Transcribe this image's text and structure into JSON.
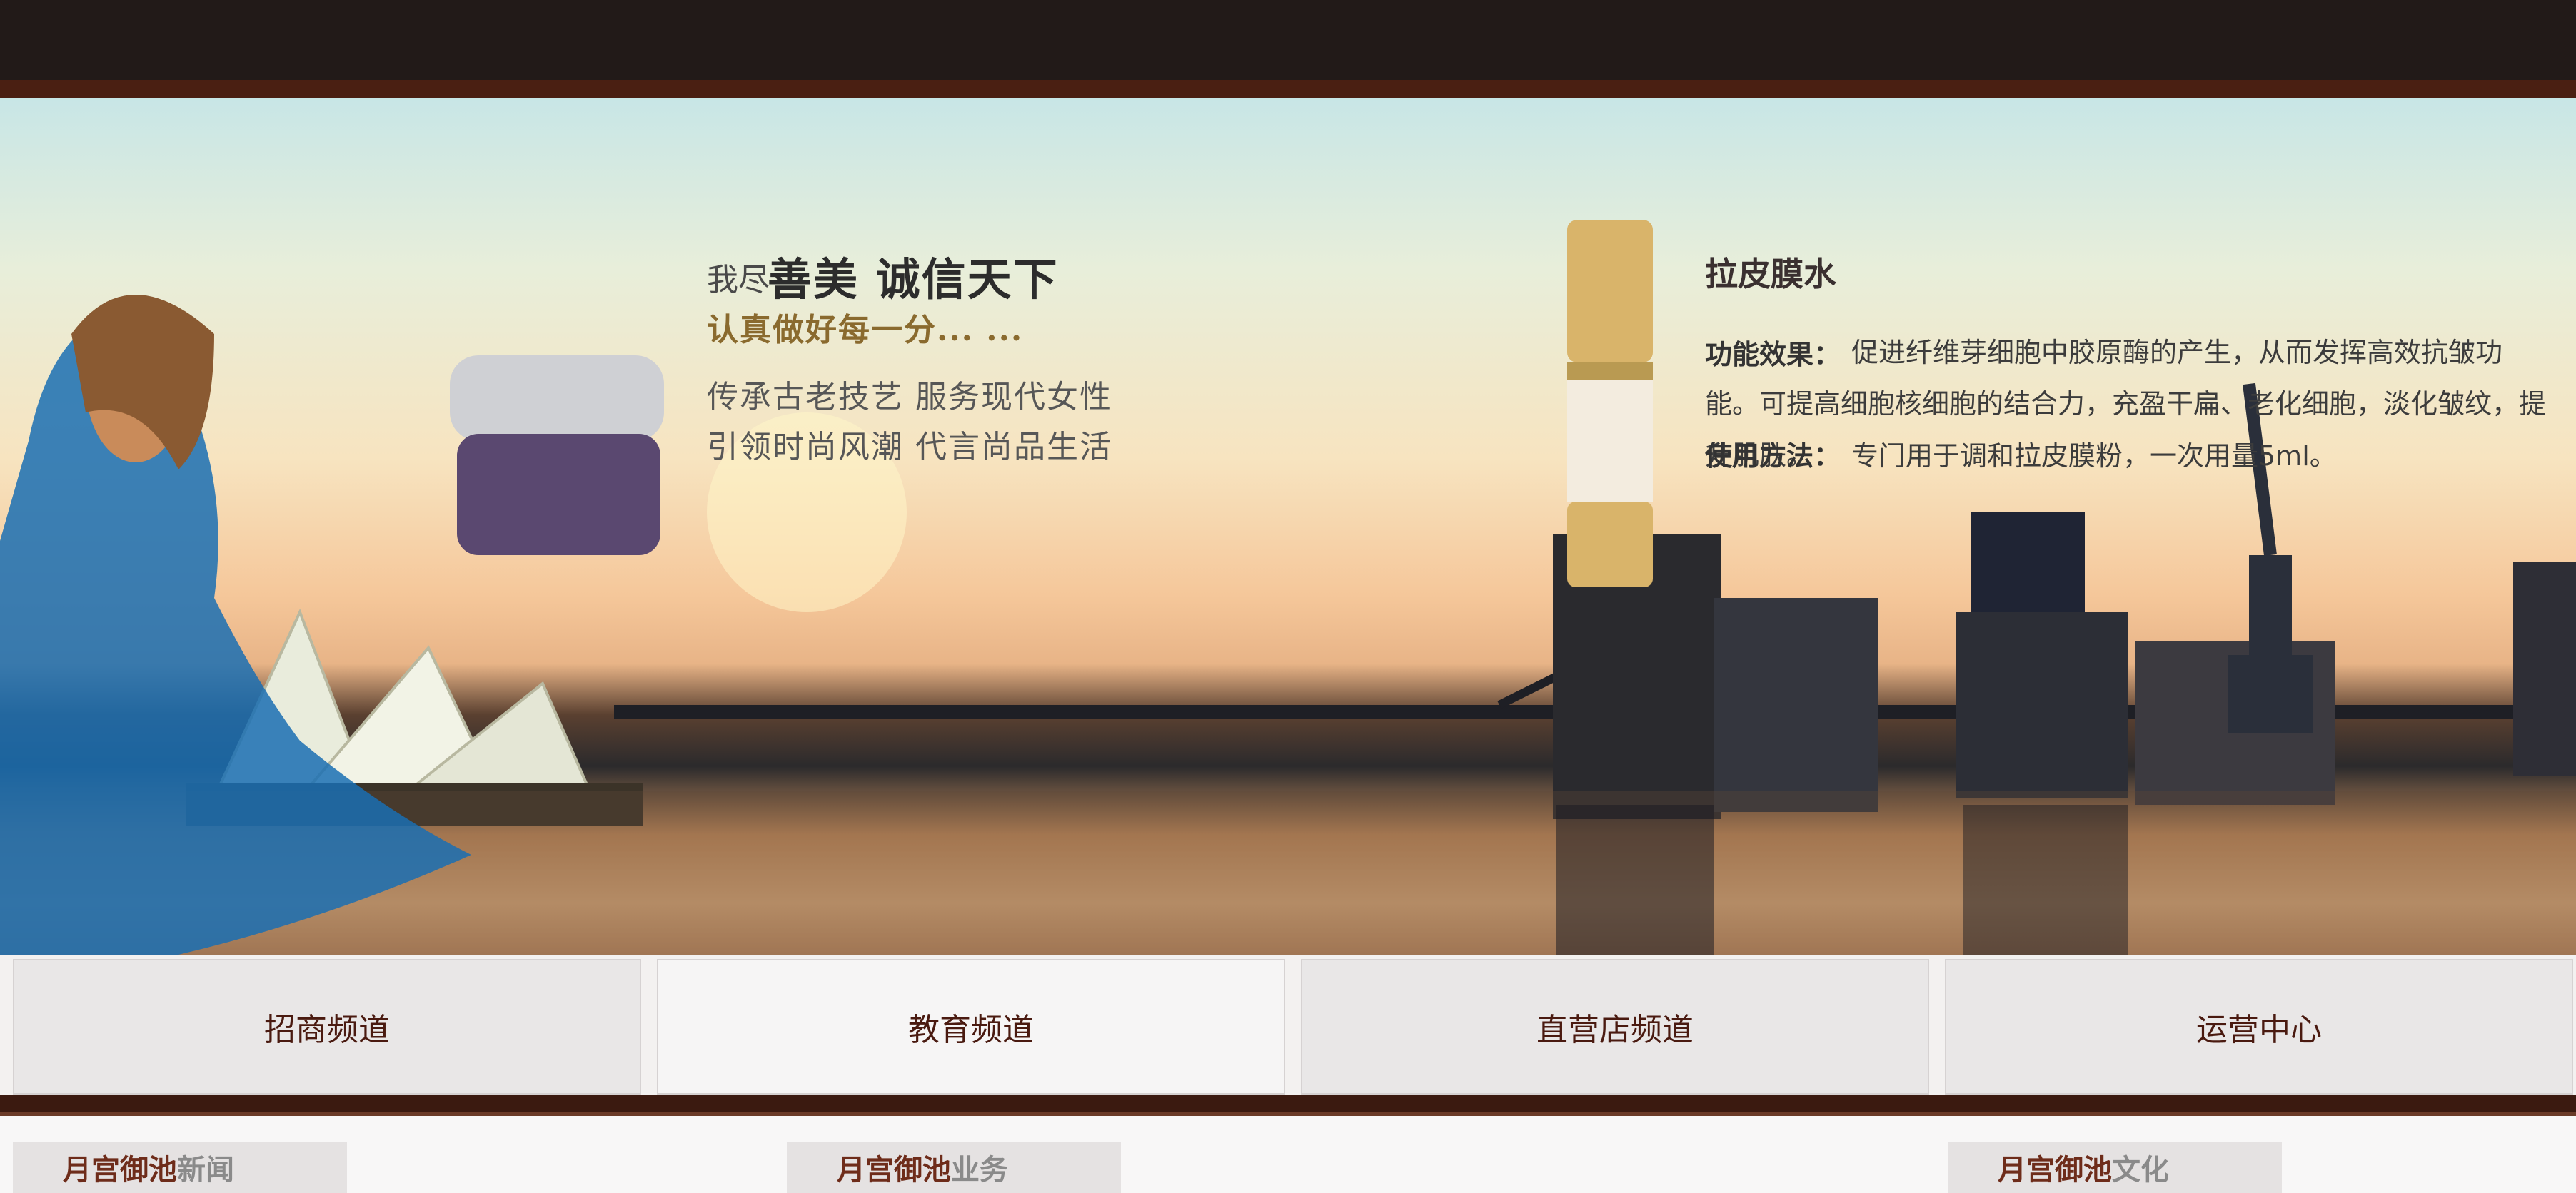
{
  "hero": {
    "tagline_small": "我尽",
    "tagline_main": "善美  诚信天下",
    "tagline_gold": "认真做好每一分...    ...",
    "slogans": [
      "传承古老技艺 服务现代女性",
      "引领时尚风潮 代言尚品生活"
    ]
  },
  "product": {
    "title": "拉皮膜水",
    "effect_label": "功能效果：",
    "effect_text": "促进纤维芽细胞中胶原酶的产生，从而发挥高效抗皱功能。可提高细胞核细胞的结合力，充盈干扁、老化细胞，淡化皱纹，提升肌肤。",
    "usage_label": "使用方法：",
    "usage_text": "专门用于调和拉皮膜粉，一次用量5ml。"
  },
  "channels": [
    "招商频道",
    "教育频道",
    "直营店频道",
    "运营中心"
  ],
  "sections": [
    {
      "brand": "月宫御池",
      "rest": "新闻"
    },
    {
      "brand": "月宫御池",
      "rest": "业务"
    },
    {
      "brand": "月宫御池",
      "rest": "文化"
    }
  ],
  "colors": {
    "topbar": "#221a18",
    "accent_brown": "#4a1f12",
    "channel_text": "#4a1a10",
    "brand_red": "#6e2c1a"
  }
}
